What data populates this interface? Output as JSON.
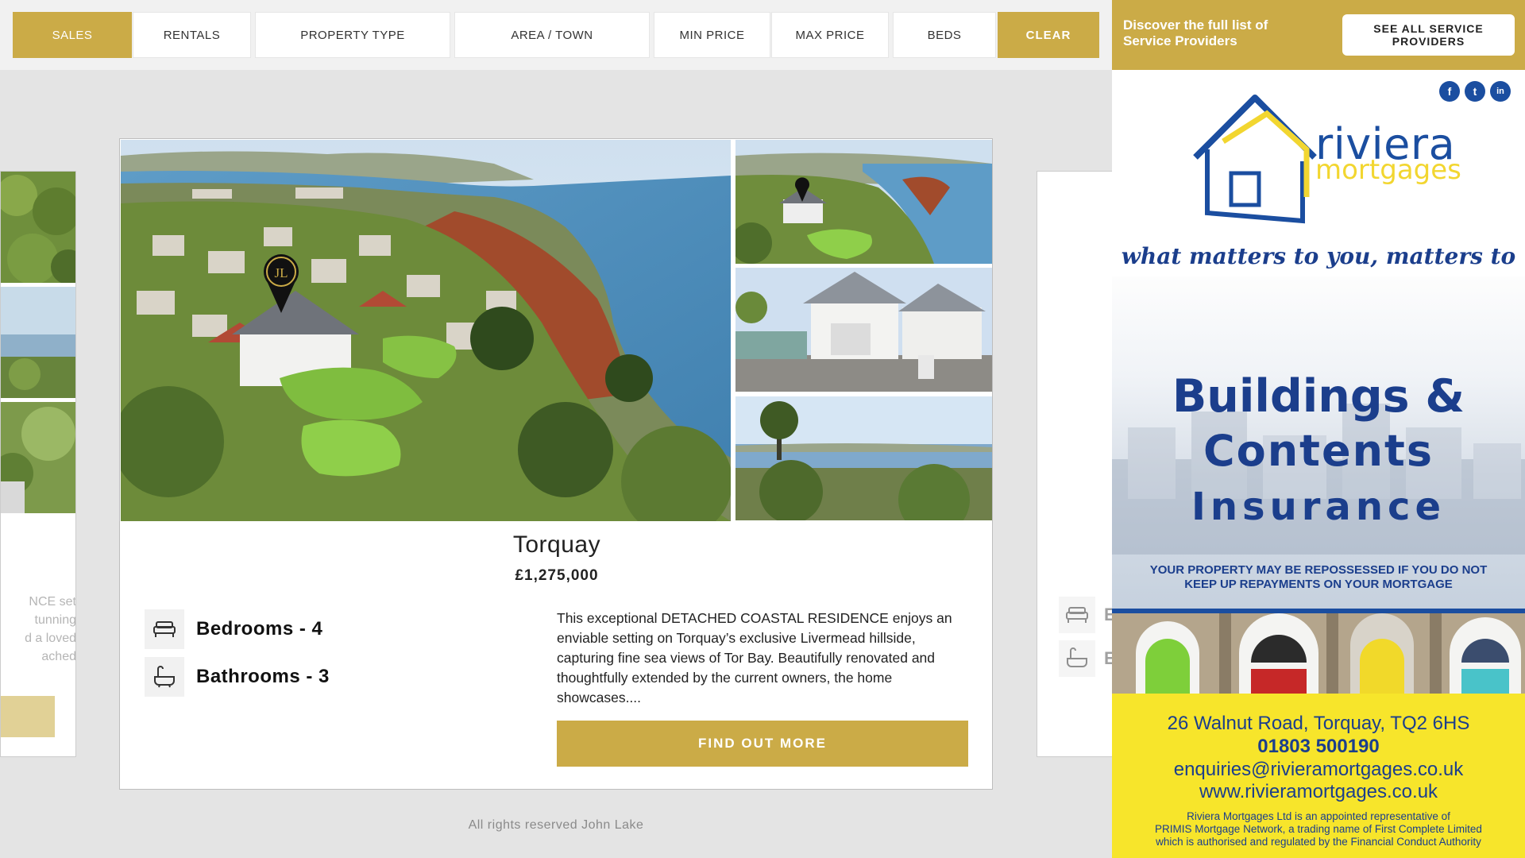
{
  "filters": [
    {
      "label": "SALES",
      "active": true
    },
    {
      "label": "RENTALS"
    },
    {
      "label": "PROPERTY TYPE"
    },
    {
      "label": "AREA / TOWN"
    },
    {
      "label": "MIN PRICE"
    },
    {
      "label": "MAX PRICE"
    },
    {
      "label": "BEDS"
    },
    {
      "label": "CLEAR",
      "active": true
    }
  ],
  "left_card": {
    "snippet": [
      "NCE set",
      "tunning",
      "d a loved",
      "ached"
    ]
  },
  "right_card": {
    "labels": [
      "E",
      "E"
    ]
  },
  "listing": {
    "title": "Torquay",
    "price": "£1,275,000",
    "bedrooms": "Bedrooms - 4",
    "bathrooms": "Bathrooms - 3",
    "description": "This exceptional DETACHED COASTAL RESIDENCE enjoys an enviable setting on Torquay’s exclusive Livermead hillside, capturing fine sea views of Tor Bay. Beautifully renovated and thoughtfully extended by the current owners, the home showcases....",
    "cta": "FIND OUT MORE",
    "pin_initials": "JL"
  },
  "footer": "All rights reserved John Lake",
  "sidebar": {
    "discover": [
      "Discover the full list of",
      "Service Providers"
    ],
    "see_all": [
      "SEE ALL SERVICE",
      "PROVIDERS"
    ]
  },
  "advert": {
    "social": [
      "f",
      "t",
      "in"
    ],
    "brand_top": "riviera",
    "brand_bottom": "mortgages",
    "tagline": "what matters to you, matters to us",
    "headline1": "Buildings &",
    "headline2": "Contents",
    "headline3": "Insurance",
    "warning": [
      "YOUR PROPERTY MAY BE REPOSSESSED IF YOU DO NOT",
      "KEEP UP REPAYMENTS ON YOUR MORTGAGE"
    ],
    "address": "26 Walnut Road, Torquay, TQ2 6HS",
    "phone": "01803 500190",
    "email": "enquiries@rivieramortgages.co.uk",
    "website": "www.rivieramortgages.co.uk",
    "legal": [
      "Riviera Mortgages Ltd is an appointed representative of",
      "PRIMIS Mortgage Network, a trading name of First Complete Limited",
      "which is authorised and regulated by the Financial Conduct Authority"
    ]
  },
  "colors": {
    "gold": "#cbab47",
    "navy": "#1b3e8c",
    "yellow": "#f7e52b"
  }
}
